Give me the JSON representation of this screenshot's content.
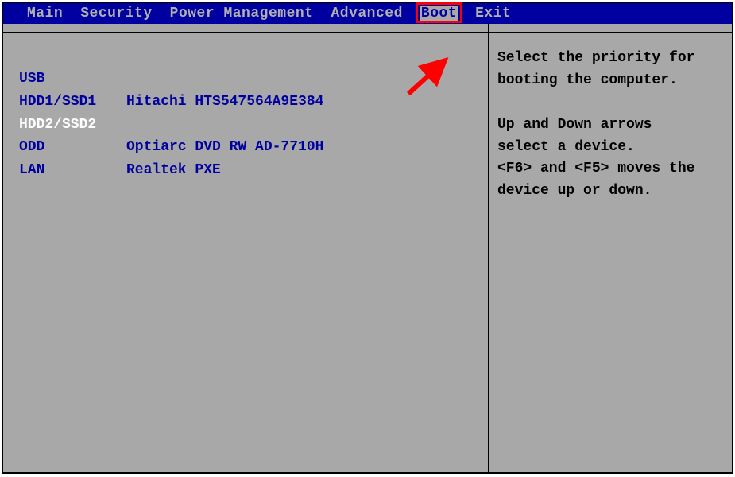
{
  "menu": {
    "items": [
      "Main",
      "Security",
      "Power Management",
      "Advanced",
      "Boot",
      "Exit"
    ],
    "active_index": 4
  },
  "boot_list": [
    {
      "label": "USB",
      "value": "",
      "selected": false
    },
    {
      "label": "HDD1/SSD1",
      "value": "Hitachi HTS547564A9E384",
      "selected": false
    },
    {
      "label": "HDD2/SSD2",
      "value": "",
      "selected": true
    },
    {
      "label": "ODD",
      "value": "Optiarc DVD RW AD-7710H",
      "selected": false
    },
    {
      "label": "LAN",
      "value": "Realtek PXE",
      "selected": false
    }
  ],
  "help": {
    "line1": "Select the priority for",
    "line2": "booting the computer.",
    "line3": "Up and Down arrows",
    "line4": "select a device.",
    "line5": "<F6> and <F5> moves the",
    "line6": "device up or down."
  },
  "annotation": {
    "arrow_color": "#ff0000",
    "highlight_color": "#ff0000"
  }
}
